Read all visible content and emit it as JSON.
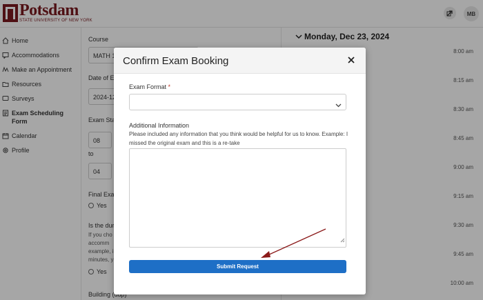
{
  "header": {
    "logo_name": "Potsdam",
    "logo_sub": "STATE UNIVERSITY OF NEW YORK",
    "avatar_initials": "MB"
  },
  "sidebar": {
    "items": [
      {
        "label": "Home",
        "icon": "home-icon"
      },
      {
        "label": "Accommodations",
        "icon": "chat-icon"
      },
      {
        "label": "Make an Appointment",
        "icon": "appointment-icon"
      },
      {
        "label": "Resources",
        "icon": "folder-icon"
      },
      {
        "label": "Surveys",
        "icon": "comment-icon"
      },
      {
        "label": "Exam Scheduling Form",
        "icon": "form-icon"
      },
      {
        "label": "Calendar",
        "icon": "calendar-icon"
      },
      {
        "label": "Profile",
        "icon": "gear-icon"
      }
    ]
  },
  "form": {
    "course_label": "Course",
    "course_value": "MATH 1",
    "date_label": "Date of E",
    "date_value": "2024-12",
    "start_label": "Exam Sta",
    "hour_value": "08",
    "to_label": "to",
    "end_hour_value": "04",
    "final_label": "Final Exa",
    "yes_label": "Yes",
    "duration_label": "Is the dur",
    "duration_help": [
      "If you cho",
      "accomm",
      "example, i",
      "minutes, y"
    ],
    "yes2_label": "Yes",
    "building_label": "Building (dup)"
  },
  "calendar": {
    "date": "Monday, Dec 23, 2024",
    "times": [
      "8:00 am",
      "8:15 am",
      "8:30 am",
      "8:45 am",
      "9:00 am",
      "9:15 am",
      "9:30 am",
      "9:45 am",
      "10:00 am"
    ]
  },
  "modal": {
    "title": "Confirm Exam Booking",
    "format_label": "Exam Format",
    "required_mark": "*",
    "format_value": "",
    "info_label": "Additional Information",
    "info_help": "Please included any information that you think would be helpful for us to know. Example: I missed the original exam and this is a re-take",
    "info_value": "",
    "submit_label": "Submit Request"
  },
  "colors": {
    "brand": "#7a1a1f",
    "accent": "#1e6fc6",
    "annotation_arrow": "#8b1a1a"
  }
}
